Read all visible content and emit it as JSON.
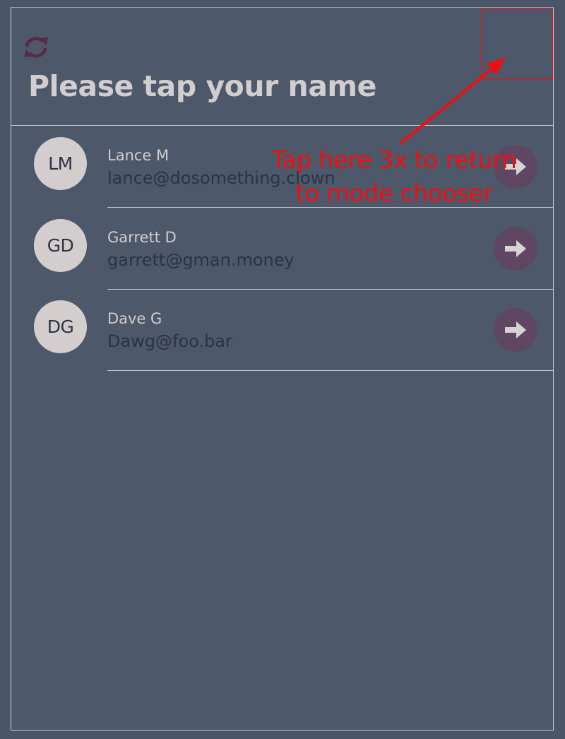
{
  "header": {
    "refresh_icon": "refresh-icon",
    "title": "Please tap your name"
  },
  "users": [
    {
      "initials": "LM",
      "name": "Lance M",
      "email": "lance@dosomething.clown",
      "action_icon": "arrow-right-icon"
    },
    {
      "initials": "GD",
      "name": "Garrett D",
      "email": "garrett@gman.money",
      "action_icon": "arrow-right-icon"
    },
    {
      "initials": "DG",
      "name": "Dave G",
      "email": "Dawg@foo.bar",
      "action_icon": "arrow-right-icon"
    }
  ],
  "annotation": {
    "line1": "Tap here 3x to return",
    "line2": "to mode chooser",
    "color": "#ee1010"
  },
  "colors": {
    "background": "#4d586b",
    "title_text": "#d2cdce",
    "avatar_bg": "#d4cdcd",
    "action_button_bg": "#5f4763",
    "refresh_icon": "#5a2a48"
  }
}
